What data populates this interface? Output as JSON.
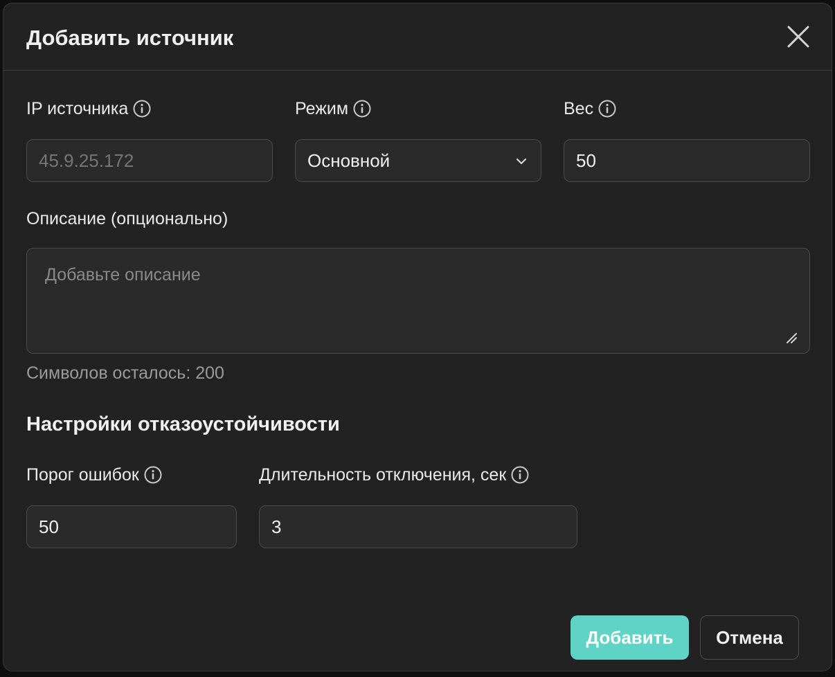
{
  "dialog": {
    "title": "Добавить источник",
    "close_icon": "close-icon"
  },
  "fields": {
    "ip": {
      "label": "IP источника",
      "value": "",
      "placeholder": "45.9.25.172",
      "info_icon": "info-icon"
    },
    "mode": {
      "label": "Режим",
      "selected": "Основной",
      "info_icon": "info-icon",
      "dropdown_icon": "chevron-down-icon"
    },
    "weight": {
      "label": "Вес",
      "value": "50",
      "info_icon": "info-icon"
    },
    "description": {
      "label": "Описание (опционально)",
      "value": "",
      "placeholder": "Добавьте описание",
      "counter": "Символов осталось: 200"
    }
  },
  "fault_tolerance": {
    "title": "Настройки отказоустойчивости",
    "error_threshold": {
      "label": "Порог ошибок",
      "value": "50",
      "info_icon": "info-icon"
    },
    "disable_duration": {
      "label": "Длительность отключения, сек",
      "value": "3",
      "info_icon": "info-icon"
    }
  },
  "actions": {
    "submit_label": "Добавить",
    "cancel_label": "Отмена"
  },
  "colors": {
    "dialog_background": "#222222",
    "field_background": "#2a2a2a",
    "field_border": "#4a4a4a",
    "accent": "#5fd3c6",
    "text": "#f0f0f0",
    "muted_text": "#8a8a8a"
  }
}
